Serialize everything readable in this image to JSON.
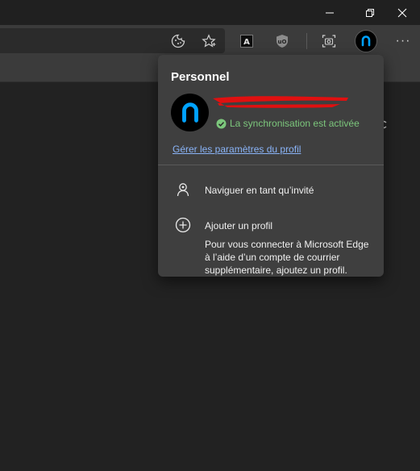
{
  "window": {
    "controls": {
      "minimize_icon": "minimize-icon",
      "restore_icon": "restore-icon",
      "close_icon": "close-icon"
    }
  },
  "toolbar": {
    "icons": [
      "cookie-icon",
      "favorite-star-icon",
      "extension-a-icon",
      "ublock-origin-icon",
      "screenshot-camera-icon",
      "profile-avatar-icon",
      "more-options-icon"
    ],
    "more_glyph": "···"
  },
  "profile_flyout": {
    "title": "Personnel",
    "sync_status": "La synchronisation est activée",
    "manage_link": "Gérer les paramètres du profil",
    "items": [
      {
        "label": "Naviguer en tant qu’invité",
        "icon": "guest-icon"
      },
      {
        "label": "Ajouter un profil",
        "icon": "add-circle-icon",
        "description": "Pour vous connecter à Microsoft Edge à l’aide d’un compte de courrier supplémentaire, ajoutez un profil."
      }
    ]
  },
  "colors": {
    "accent_avatar": "#00a2ff",
    "sync_green": "#7cc77c",
    "link_blue": "#8ab4f8",
    "redaction": "#e01010"
  }
}
